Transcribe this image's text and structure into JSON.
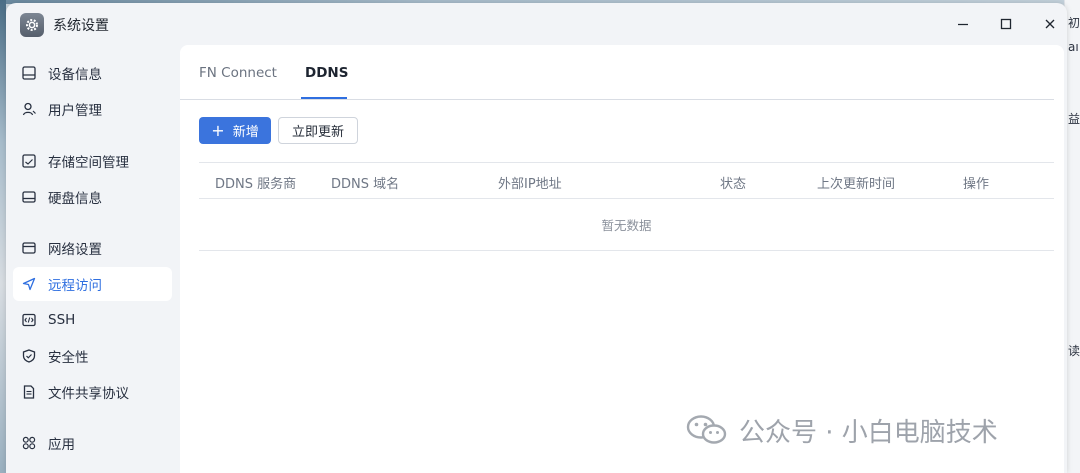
{
  "window": {
    "title": "系统设置",
    "controls": [
      "minimize",
      "maximize",
      "close"
    ]
  },
  "sidebar": {
    "items": [
      {
        "label": "设备信息",
        "icon": "device-icon"
      },
      {
        "label": "用户管理",
        "icon": "user-icon"
      },
      {
        "label": "存储空间管理",
        "icon": "storage-icon"
      },
      {
        "label": "硬盘信息",
        "icon": "disk-icon"
      },
      {
        "label": "网络设置",
        "icon": "network-icon"
      },
      {
        "label": "远程访问",
        "icon": "remote-icon",
        "active": true
      },
      {
        "label": "SSH",
        "icon": "ssh-icon"
      },
      {
        "label": "安全性",
        "icon": "shield-icon"
      },
      {
        "label": "文件共享协议",
        "icon": "file-share-icon"
      },
      {
        "label": "应用",
        "icon": "apps-icon"
      }
    ]
  },
  "tabs": [
    {
      "label": "FN Connect",
      "active": false
    },
    {
      "label": "DDNS",
      "active": true
    }
  ],
  "toolbar": {
    "add_label": "新增",
    "update_label": "立即更新"
  },
  "table": {
    "columns": [
      "DDNS 服务商",
      "DDNS 域名",
      "外部IP地址",
      "状态",
      "上次更新时间",
      "操作"
    ],
    "empty_text": "暂无数据"
  },
  "watermark": {
    "text": "公众号 · 小白电脑技术"
  },
  "desktop_right_fragments": [
    "初",
    "aı",
    "益",
    "读"
  ],
  "colors": {
    "accent": "#3b74dd",
    "active_text": "#2f6fe0",
    "window_bg": "#f2f4f7",
    "panel_bg": "#ffffff"
  }
}
